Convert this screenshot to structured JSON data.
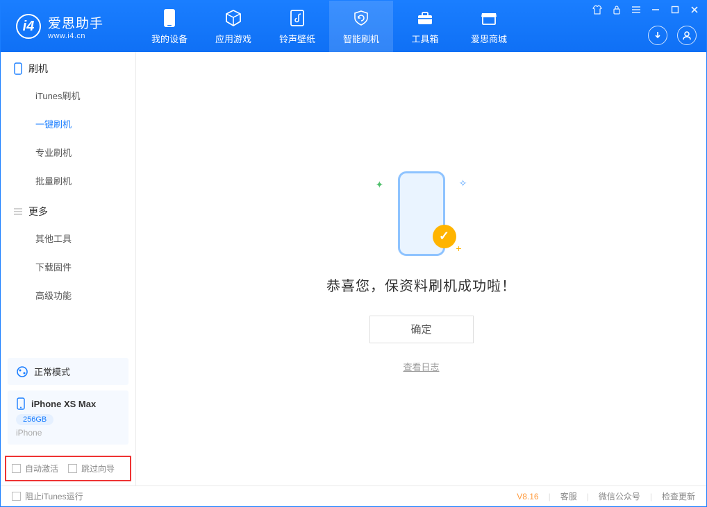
{
  "app": {
    "name_cn": "爱思助手",
    "name_en": "www.i4.cn"
  },
  "nav": {
    "tabs": [
      {
        "label": "我的设备"
      },
      {
        "label": "应用游戏"
      },
      {
        "label": "铃声壁纸"
      },
      {
        "label": "智能刷机"
      },
      {
        "label": "工具箱"
      },
      {
        "label": "爱思商城"
      }
    ]
  },
  "sidebar": {
    "section1_title": "刷机",
    "items1": [
      {
        "label": "iTunes刷机"
      },
      {
        "label": "一键刷机"
      },
      {
        "label": "专业刷机"
      },
      {
        "label": "批量刷机"
      }
    ],
    "section2_title": "更多",
    "items2": [
      {
        "label": "其他工具"
      },
      {
        "label": "下载固件"
      },
      {
        "label": "高级功能"
      }
    ],
    "status_label": "正常模式",
    "device": {
      "name": "iPhone XS Max",
      "capacity": "256GB",
      "type": "iPhone"
    },
    "check_auto_activate": "自动激活",
    "check_skip_guide": "跳过向导"
  },
  "main": {
    "success_text": "恭喜您，保资料刷机成功啦！",
    "ok_label": "确定",
    "log_link": "查看日志"
  },
  "footer": {
    "block_itunes": "阻止iTunes运行",
    "version": "V8.16",
    "support": "客服",
    "wechat": "微信公众号",
    "check_update": "检查更新"
  }
}
